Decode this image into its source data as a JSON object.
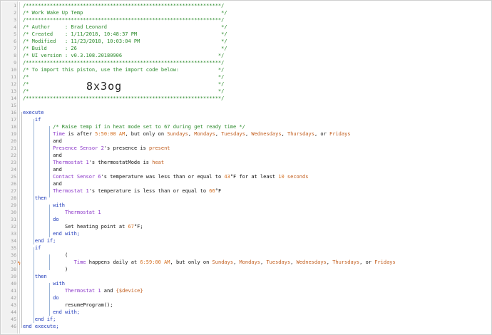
{
  "lines": [
    {
      "n": "1",
      "segs": [
        {
          "c": "cm",
          "t": "/*****************************************************************/"
        }
      ]
    },
    {
      "n": "2",
      "segs": [
        {
          "c": "cm",
          "t": "/* Work Wake Up Temp                                              */"
        }
      ]
    },
    {
      "n": "3",
      "segs": [
        {
          "c": "cm",
          "t": "/*****************************************************************/"
        }
      ]
    },
    {
      "n": "4",
      "segs": [
        {
          "c": "cm",
          "t": "/* Author     : Brad Leonard                                      */"
        }
      ]
    },
    {
      "n": "5",
      "segs": [
        {
          "c": "cm",
          "t": "/* Created    : 1/11/2018, 10:48:37 PM                            */"
        }
      ]
    },
    {
      "n": "6",
      "segs": [
        {
          "c": "cm",
          "t": "/* Modified   : 11/23/2018, 10:03:04 PM                           */"
        }
      ]
    },
    {
      "n": "7",
      "segs": [
        {
          "c": "cm",
          "t": "/* Build      : 26                                                */"
        }
      ]
    },
    {
      "n": "8",
      "segs": [
        {
          "c": "cm",
          "t": "/* UI version : v0.3.108.20180906                                */"
        }
      ]
    },
    {
      "n": "9",
      "segs": [
        {
          "c": "cm",
          "t": "/*****************************************************************/"
        }
      ]
    },
    {
      "n": "10",
      "segs": [
        {
          "c": "cm",
          "t": "/* To import this piston, use the import code below:             */"
        }
      ]
    },
    {
      "n": "11",
      "segs": [
        {
          "c": "cm",
          "t": "/*                                                               */"
        }
      ]
    },
    {
      "n": "12",
      "segs": [
        {
          "c": "cm",
          "t": "/*                                                               */"
        }
      ]
    },
    {
      "n": "13",
      "segs": [
        {
          "c": "cm",
          "t": "/*                                                               */"
        }
      ]
    },
    {
      "n": "14",
      "segs": [
        {
          "c": "cm",
          "t": "/*****************************************************************/"
        }
      ]
    },
    {
      "n": "15",
      "segs": []
    },
    {
      "n": "16",
      "segs": [
        {
          "c": "kw",
          "t": "execute"
        }
      ]
    },
    {
      "n": "17",
      "segs": [
        {
          "c": "kw",
          "t": "    if"
        }
      ]
    },
    {
      "n": "18",
      "segs": [
        {
          "c": "cm",
          "t": "          /* Raise temp if in heat mode set to 67 during get ready time */"
        }
      ]
    },
    {
      "n": "19",
      "segs": [
        {
          "c": "dv",
          "t": "          Time"
        },
        {
          "c": "tx",
          "t": " is after "
        },
        {
          "c": "nm",
          "t": "5:50:00 AM"
        },
        {
          "c": "tx",
          "t": ", but only on "
        },
        {
          "c": "vr",
          "t": "Sundays"
        },
        {
          "c": "tx",
          "t": ", "
        },
        {
          "c": "vr",
          "t": "Mondays"
        },
        {
          "c": "tx",
          "t": ", "
        },
        {
          "c": "vr",
          "t": "Tuesdays"
        },
        {
          "c": "tx",
          "t": ", "
        },
        {
          "c": "vr",
          "t": "Wednesdays"
        },
        {
          "c": "tx",
          "t": ", "
        },
        {
          "c": "vr",
          "t": "Thursdays"
        },
        {
          "c": "tx",
          "t": ", or "
        },
        {
          "c": "vr",
          "t": "Fridays"
        }
      ]
    },
    {
      "n": "20",
      "segs": [
        {
          "c": "tx",
          "t": "          and"
        }
      ]
    },
    {
      "n": "21",
      "segs": [
        {
          "c": "dv",
          "t": "          Presence Sensor 2"
        },
        {
          "c": "tx",
          "t": "'s presence is "
        },
        {
          "c": "vr",
          "t": "present"
        }
      ]
    },
    {
      "n": "22",
      "segs": [
        {
          "c": "tx",
          "t": "          and"
        }
      ]
    },
    {
      "n": "23",
      "segs": [
        {
          "c": "dv",
          "t": "          Thermostat 1"
        },
        {
          "c": "tx",
          "t": "'s thermostatMode is "
        },
        {
          "c": "vr",
          "t": "heat"
        }
      ]
    },
    {
      "n": "24",
      "segs": [
        {
          "c": "tx",
          "t": "          and"
        }
      ]
    },
    {
      "n": "25",
      "segs": [
        {
          "c": "dv",
          "t": "          Contact Sensor 6"
        },
        {
          "c": "tx",
          "t": "'s temperature was less than or equal to "
        },
        {
          "c": "nm",
          "t": "43"
        },
        {
          "c": "tx",
          "t": "°F for at least "
        },
        {
          "c": "nm",
          "t": "10"
        },
        {
          "c": "tx",
          "t": " "
        },
        {
          "c": "vr",
          "t": "seconds"
        }
      ]
    },
    {
      "n": "26",
      "segs": [
        {
          "c": "tx",
          "t": "          and"
        }
      ]
    },
    {
      "n": "27",
      "segs": [
        {
          "c": "dv",
          "t": "          Thermostat 1"
        },
        {
          "c": "tx",
          "t": "'s temperature is less than or equal to "
        },
        {
          "c": "nm",
          "t": "66"
        },
        {
          "c": "tx",
          "t": "°F"
        }
      ]
    },
    {
      "n": "28",
      "segs": [
        {
          "c": "kw",
          "t": "    then"
        }
      ]
    },
    {
      "n": "29",
      "segs": [
        {
          "c": "kw",
          "t": "          with"
        }
      ]
    },
    {
      "n": "30",
      "segs": [
        {
          "c": "dv",
          "t": "              Thermostat 1"
        }
      ]
    },
    {
      "n": "31",
      "segs": [
        {
          "c": "kw",
          "t": "          do"
        }
      ]
    },
    {
      "n": "32",
      "segs": [
        {
          "c": "tx",
          "t": "              Set heating point at "
        },
        {
          "c": "nm",
          "t": "67"
        },
        {
          "c": "tx",
          "t": "°F;"
        }
      ]
    },
    {
      "n": "33",
      "segs": [
        {
          "c": "kw",
          "t": "          end with;"
        }
      ]
    },
    {
      "n": "34",
      "segs": [
        {
          "c": "kw",
          "t": "    end if;"
        }
      ]
    },
    {
      "n": "35",
      "segs": [
        {
          "c": "kw",
          "t": "    if"
        }
      ]
    },
    {
      "n": "36",
      "segs": [
        {
          "c": "tx",
          "t": "              ("
        }
      ]
    },
    {
      "n": "37",
      "segs": [
        {
          "c": "dv",
          "t": "                 Time"
        },
        {
          "c": "tx",
          "t": " happens daily at "
        },
        {
          "c": "nm",
          "t": "6:59:00 AM"
        },
        {
          "c": "tx",
          "t": ", but only on "
        },
        {
          "c": "vr",
          "t": "Sundays"
        },
        {
          "c": "tx",
          "t": ", "
        },
        {
          "c": "vr",
          "t": "Mondays"
        },
        {
          "c": "tx",
          "t": ", "
        },
        {
          "c": "vr",
          "t": "Tuesdays"
        },
        {
          "c": "tx",
          "t": ", "
        },
        {
          "c": "vr",
          "t": "Wednesdays"
        },
        {
          "c": "tx",
          "t": ", "
        },
        {
          "c": "vr",
          "t": "Thursdays"
        },
        {
          "c": "tx",
          "t": ", or "
        },
        {
          "c": "vr",
          "t": "Fridays"
        }
      ]
    },
    {
      "n": "38",
      "segs": [
        {
          "c": "tx",
          "t": "              )"
        }
      ]
    },
    {
      "n": "39",
      "segs": [
        {
          "c": "kw",
          "t": "    then"
        }
      ]
    },
    {
      "n": "40",
      "segs": [
        {
          "c": "kw",
          "t": "          with"
        }
      ]
    },
    {
      "n": "41",
      "segs": [
        {
          "c": "dv",
          "t": "              Thermostat 1"
        },
        {
          "c": "tx",
          "t": " and "
        },
        {
          "c": "vr",
          "t": "{$device}"
        }
      ]
    },
    {
      "n": "42",
      "segs": [
        {
          "c": "kw",
          "t": "          do"
        }
      ]
    },
    {
      "n": "43",
      "segs": [
        {
          "c": "tx",
          "t": "              resumeProgram();"
        }
      ]
    },
    {
      "n": "44",
      "segs": [
        {
          "c": "kw",
          "t": "          end with;"
        }
      ]
    },
    {
      "n": "45",
      "segs": [
        {
          "c": "kw",
          "t": "    end if;"
        }
      ]
    },
    {
      "n": "46",
      "segs": [
        {
          "c": "kw",
          "t": "end execute;"
        }
      ]
    }
  ],
  "import_code": "8x3og",
  "colors": {
    "comment": "#2a8a2a",
    "keyword": "#1a36b8",
    "device": "#8a35c8",
    "number": "#d46e1e",
    "value": "#c25e1e"
  },
  "trigger_icon": "lightning-bolt-icon"
}
